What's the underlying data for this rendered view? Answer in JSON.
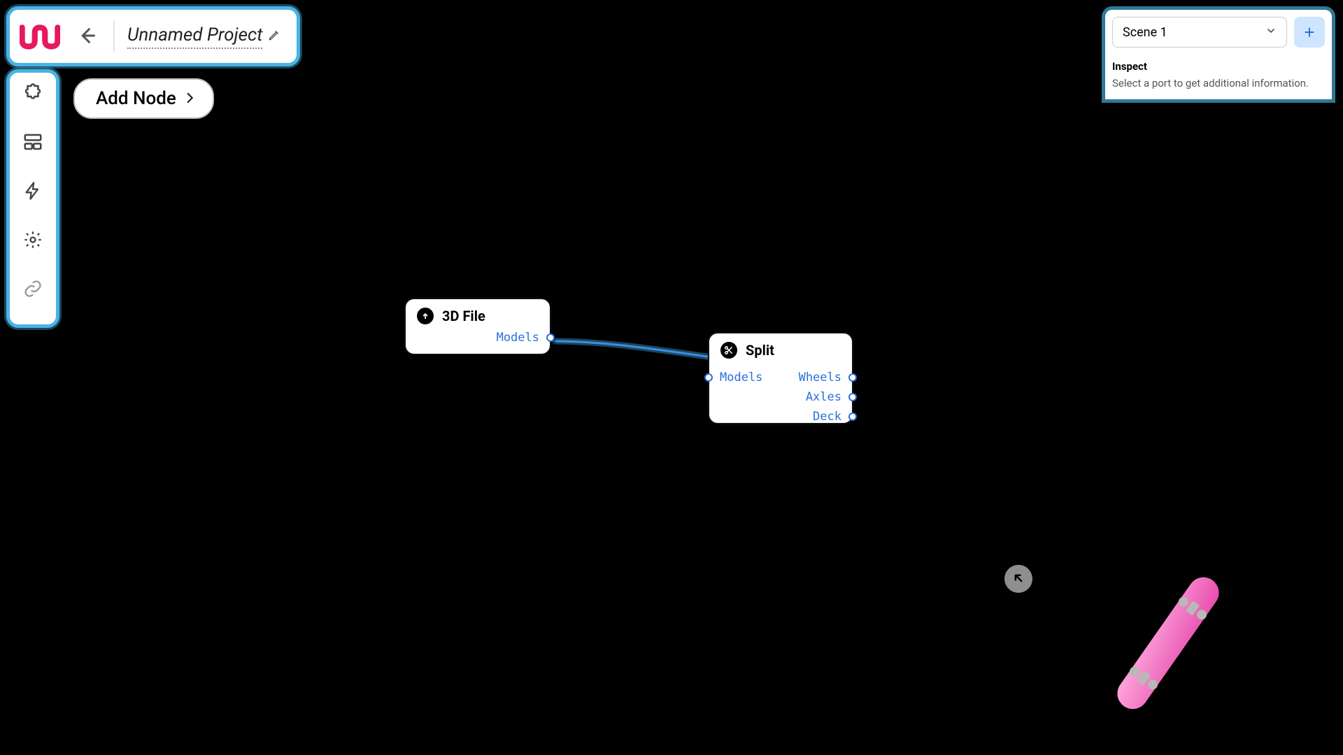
{
  "header": {
    "project_title": "Unnamed Project"
  },
  "popover": {
    "add_node_label": "Add Node"
  },
  "right_panel": {
    "scene_select_value": "Scene 1",
    "inspect_title": "Inspect",
    "inspect_body": "Select a port to get additional information."
  },
  "nodes": {
    "file3d": {
      "title": "3D File",
      "outputs": [
        "Models"
      ]
    },
    "split": {
      "title": "Split",
      "inputs": [
        "Models"
      ],
      "outputs": [
        "Wheels",
        "Axles",
        "Deck"
      ]
    }
  },
  "icons": {
    "back": "arrow-left",
    "edit": "pencil",
    "sidebar": [
      "puzzle",
      "layout",
      "bolt",
      "gear",
      "link"
    ],
    "add_scene": "plus",
    "chevron": "chevron-right",
    "corner": "arrow-up-left"
  },
  "preview": {
    "object": "pink-skateboard"
  }
}
